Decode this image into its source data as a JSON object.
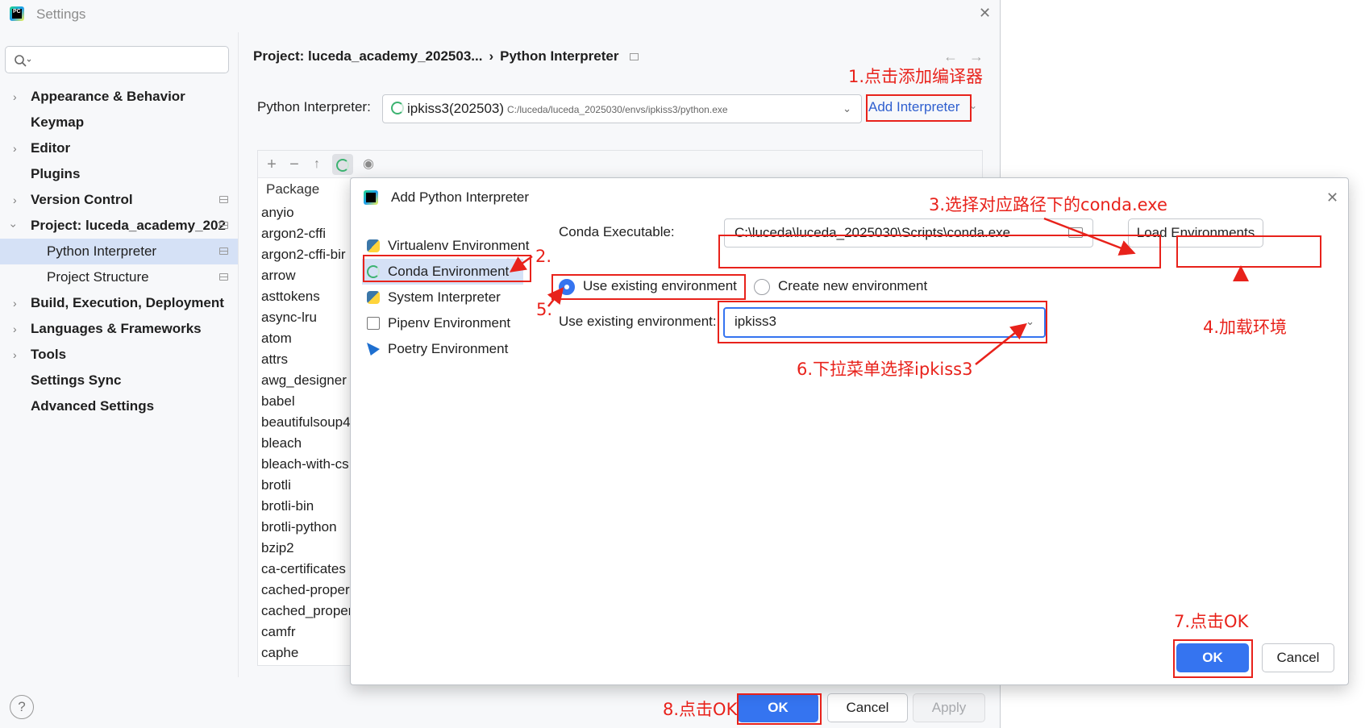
{
  "settings": {
    "title": "Settings",
    "nav": [
      {
        "label": "Appearance & Behavior",
        "chevron": true
      },
      {
        "label": "Keymap"
      },
      {
        "label": "Editor",
        "chevron": true
      },
      {
        "label": "Plugins"
      },
      {
        "label": "Version Control",
        "chevron": true
      },
      {
        "label": "Project: luceda_academy_202",
        "chevron": true
      },
      {
        "label": "Python Interpreter"
      },
      {
        "label": "Project Structure"
      },
      {
        "label": "Build, Execution, Deployment",
        "chevron": true
      },
      {
        "label": "Languages & Frameworks",
        "chevron": true
      },
      {
        "label": "Tools",
        "chevron": true
      },
      {
        "label": "Settings Sync"
      },
      {
        "label": "Advanced Settings"
      }
    ],
    "breadcrumb": {
      "project": "Project: luceda_academy_202503...",
      "separator": "›",
      "page": "Python Interpreter"
    },
    "interpreter_label": "Python Interpreter:",
    "interpreter_name": "ipkiss3(202503)",
    "interpreter_path": "C:/luceda/luceda_2025030/envs/ipkiss3/python.exe",
    "add_interpreter": "Add Interpreter",
    "package_header": "Package",
    "packages": [
      "anyio",
      "argon2-cffi",
      "argon2-cffi-bir",
      "arrow",
      "asttokens",
      "async-lru",
      "atom",
      "attrs",
      "awg_designer",
      "babel",
      "beautifulsoup4",
      "bleach",
      "bleach-with-cs",
      "brotli",
      "brotli-bin",
      "brotli-python",
      "bzip2",
      "ca-certificates",
      "cached-proper",
      "cached_proper",
      "camfr",
      "caphe"
    ],
    "buttons": {
      "ok": "OK",
      "cancel": "Cancel",
      "apply": "Apply",
      "help": "?"
    }
  },
  "dialog": {
    "title": "Add Python Interpreter",
    "environments": [
      "Virtualenv Environment",
      "Conda Environment",
      "System Interpreter",
      "Pipenv Environment",
      "Poetry Environment"
    ],
    "conda_exec_label": "Conda Executable:",
    "conda_exec_value": "C:\\luceda\\luceda_2025030\\Scripts\\conda.exe",
    "load_env": "Load Environments",
    "radio_existing": "Use existing environment",
    "radio_new": "Create new environment",
    "existing_env_label": "Use existing environment:",
    "existing_env_value": "ipkiss3",
    "ok": "OK",
    "cancel": "Cancel"
  },
  "annotations": {
    "step1": "1.点击添加编译器",
    "step2": "2.",
    "step3": "3.选择对应路径下的conda.exe",
    "step4": "4.加载环境",
    "step5": "5.",
    "step6": "6.下拉菜单选择ipkiss3",
    "step7": "7.点击OK",
    "step8": "8.点击OK",
    "color": "#e8221b"
  },
  "colors": {
    "accent": "#3574f0",
    "selection": "#d5e1f6",
    "link": "#2f5fcf"
  }
}
